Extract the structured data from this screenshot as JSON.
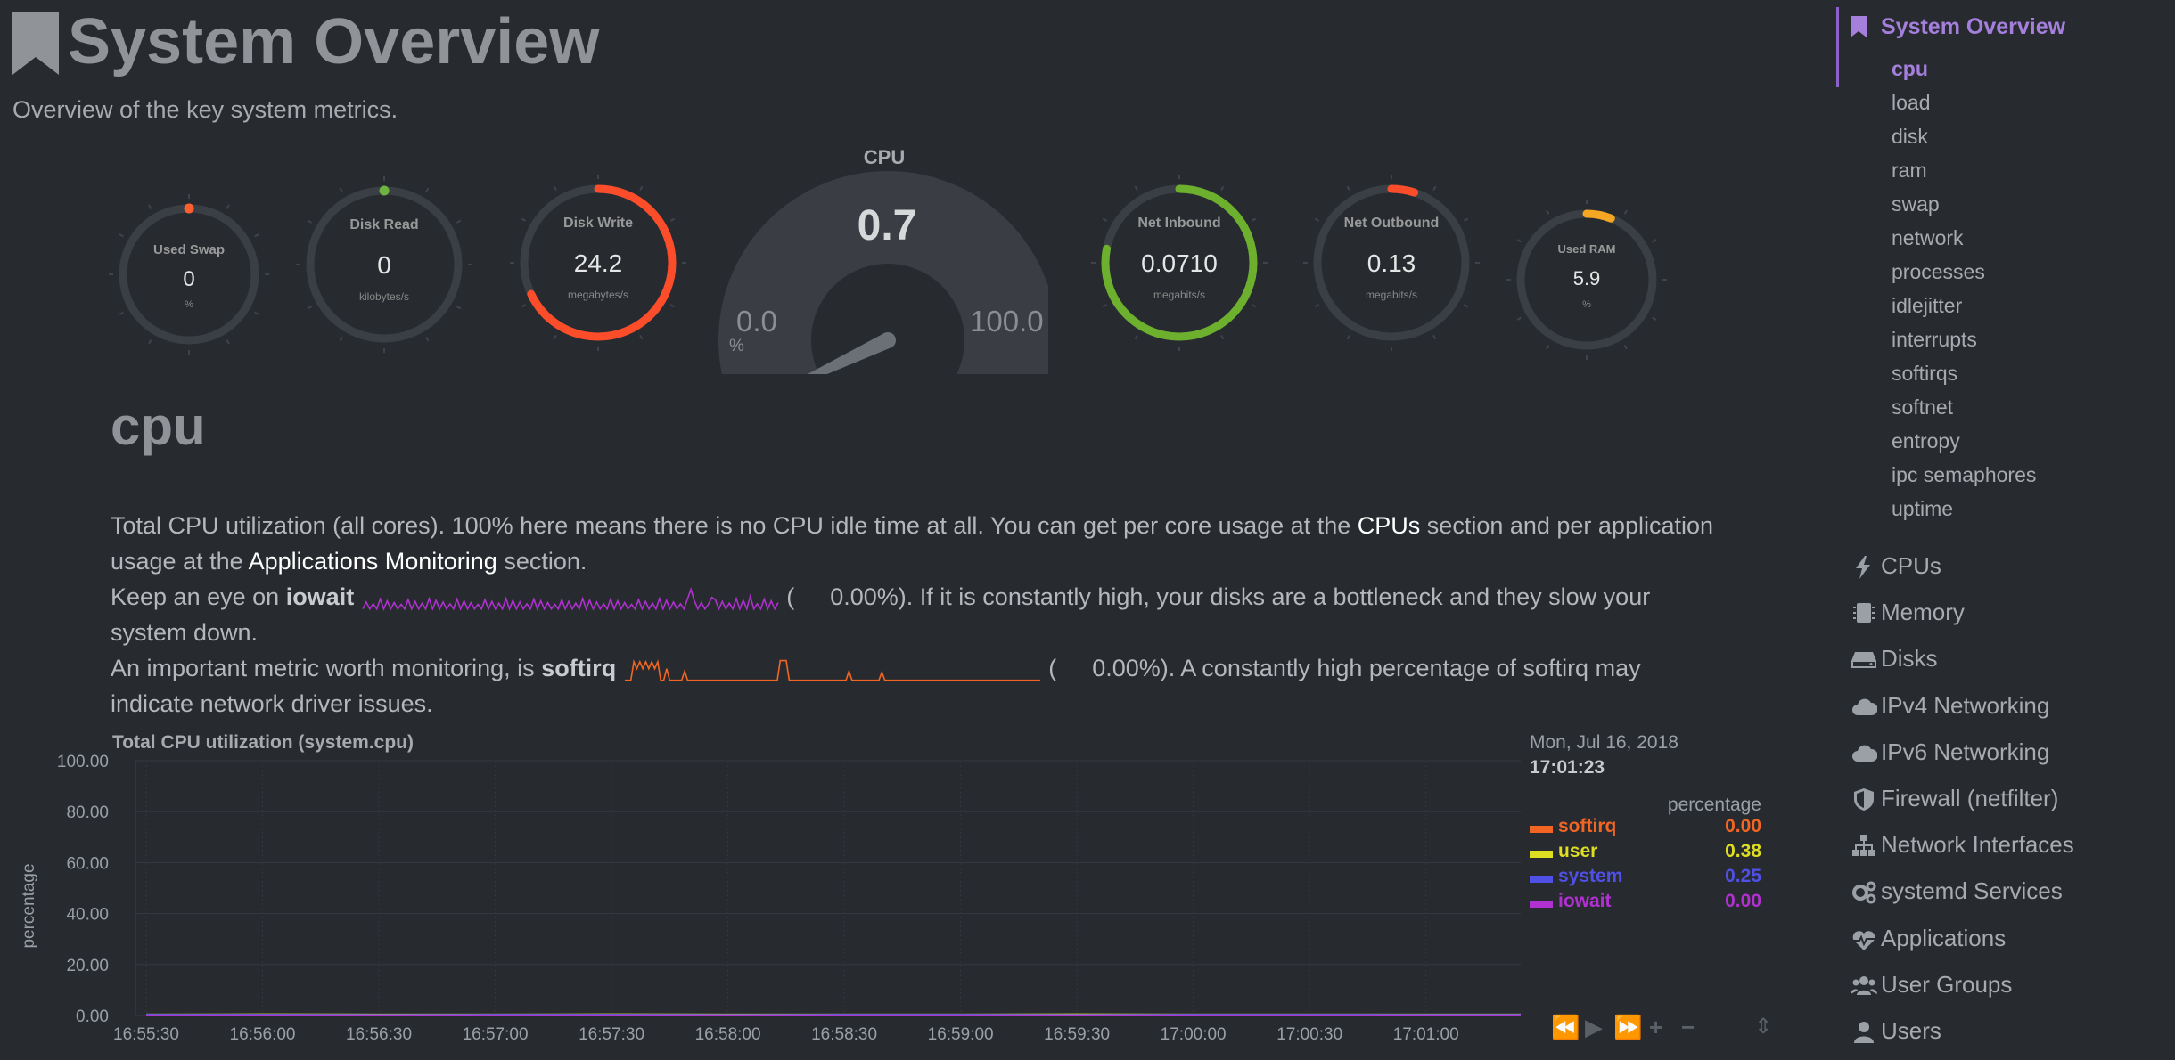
{
  "header": {
    "title": "System Overview",
    "subtitle": "Overview of the key system metrics."
  },
  "gauges": {
    "used_swap": {
      "title": "Used Swap",
      "value": "0",
      "unit": "%",
      "fraction": 0.0,
      "color": "#ff5f2e"
    },
    "disk_read": {
      "title": "Disk Read",
      "value": "0",
      "unit": "kilobytes/s",
      "fraction": 0.0,
      "color": "#6cb33f"
    },
    "disk_write": {
      "title": "Disk Write",
      "value": "24.2",
      "unit": "megabytes/s",
      "fraction": 0.68,
      "color": "#fc4d2b"
    },
    "net_inbound": {
      "title": "Net Inbound",
      "value": "0.0710",
      "unit": "megabits/s",
      "fraction": 0.78,
      "color": "#6cb02e"
    },
    "net_outbound": {
      "title": "Net Outbound",
      "value": "0.13",
      "unit": "megabits/s",
      "fraction": 0.05,
      "color": "#fc4d2b"
    },
    "used_ram": {
      "title": "Used RAM",
      "value": "5.9",
      "unit": "%",
      "fraction": 0.06,
      "color": "#f5a623"
    }
  },
  "cpu_gauge": {
    "title": "CPU",
    "value": "0.7",
    "min": "0.0",
    "max": "100.0",
    "unit": "%",
    "fraction": 0.007,
    "color": "#3e8f86"
  },
  "section": {
    "title": "cpu",
    "desc_line1": "Total CPU utilization (all cores). 100% here means there is no CPU idle time at all. You can get per core usage at the",
    "link_cpus": "CPUs",
    "desc_line1b": "section and per application",
    "desc_line2a": "usage at the",
    "link_apps": "Applications Monitoring",
    "desc_line2b": "section.",
    "desc_line3a": "Keep an eye on",
    "iowait_label": "iowait",
    "iowait_paren_open": "(",
    "iowait_value": "0.00%",
    "desc_line3b": "). If it is constantly high, your disks are a bottleneck and they slow your",
    "desc_line4": "system down.",
    "desc_line5a": "An important metric worth monitoring, is",
    "softirq_label": "softirq",
    "softirq_paren_open": "(",
    "softirq_value": "0.00%",
    "desc_line5b": "). A constantly high percentage of softirq may",
    "desc_line6": "indicate network driver issues."
  },
  "chart_data": {
    "type": "line",
    "title": "Total CPU utilization (system.cpu)",
    "ylabel": "percentage",
    "xlabel": "",
    "ylim": [
      0,
      100
    ],
    "y_ticks": [
      "100.00",
      "80.00",
      "60.00",
      "40.00",
      "20.00",
      "0.00"
    ],
    "x": [
      "16:55:30",
      "16:56:00",
      "16:56:30",
      "16:57:00",
      "16:57:30",
      "16:58:00",
      "16:58:30",
      "16:59:00",
      "16:59:30",
      "17:00:00",
      "17:00:30",
      "17:01:00"
    ],
    "grid": true,
    "legend": "right",
    "series": [
      {
        "name": "softirq",
        "color": "#f26522",
        "values": [
          0,
          0,
          0,
          0,
          0,
          0,
          0,
          0,
          0,
          0,
          0,
          0
        ]
      },
      {
        "name": "user",
        "color": "#dddd22",
        "values": [
          0.4,
          0.5,
          0.4,
          0.4,
          0.5,
          0.4,
          0.4,
          0.4,
          0.5,
          0.4,
          0.4,
          0.38
        ]
      },
      {
        "name": "system",
        "color": "#5050e6",
        "values": [
          0.3,
          0.3,
          0.2,
          0.3,
          0.3,
          0.2,
          0.3,
          0.3,
          0.2,
          0.3,
          0.3,
          0.25
        ]
      },
      {
        "name": "iowait",
        "color": "#b030d0",
        "values": [
          0,
          0,
          0,
          0,
          0,
          0,
          0,
          0,
          0,
          0,
          0,
          0
        ]
      }
    ]
  },
  "legend": {
    "date": "Mon, Jul 16, 2018",
    "time": "17:01:23",
    "units": "percentage",
    "rows": [
      {
        "name": "softirq",
        "value": "0.00",
        "color": "#f26522"
      },
      {
        "name": "user",
        "value": "0.38",
        "color": "#dddd22"
      },
      {
        "name": "system",
        "value": "0.25",
        "color": "#5050e6"
      },
      {
        "name": "iowait",
        "value": "0.00",
        "color": "#b030d0"
      }
    ]
  },
  "controls": {
    "rewind": "⏪",
    "play": "▶",
    "forward": "⏩",
    "zoom_in": "+",
    "zoom_out": "−",
    "resize": "⇕"
  },
  "sidebar": {
    "active": "System Overview",
    "subitems": [
      "cpu",
      "load",
      "disk",
      "ram",
      "swap",
      "network",
      "processes",
      "idlejitter",
      "interrupts",
      "softirqs",
      "softnet",
      "entropy",
      "ipc semaphores",
      "uptime"
    ],
    "menu": [
      {
        "label": "CPUs",
        "icon": "bolt-icon"
      },
      {
        "label": "Memory",
        "icon": "memory-icon"
      },
      {
        "label": "Disks",
        "icon": "hdd-icon"
      },
      {
        "label": "IPv4 Networking",
        "icon": "cloud-icon"
      },
      {
        "label": "IPv6 Networking",
        "icon": "cloud-icon"
      },
      {
        "label": "Firewall (netfilter)",
        "icon": "shield-icon"
      },
      {
        "label": "Network Interfaces",
        "icon": "sitemap-icon"
      },
      {
        "label": "systemd Services",
        "icon": "cogs-icon"
      },
      {
        "label": "Applications",
        "icon": "heartbeat-icon"
      },
      {
        "label": "User Groups",
        "icon": "users-icon"
      },
      {
        "label": "Users",
        "icon": "user-icon"
      }
    ]
  }
}
